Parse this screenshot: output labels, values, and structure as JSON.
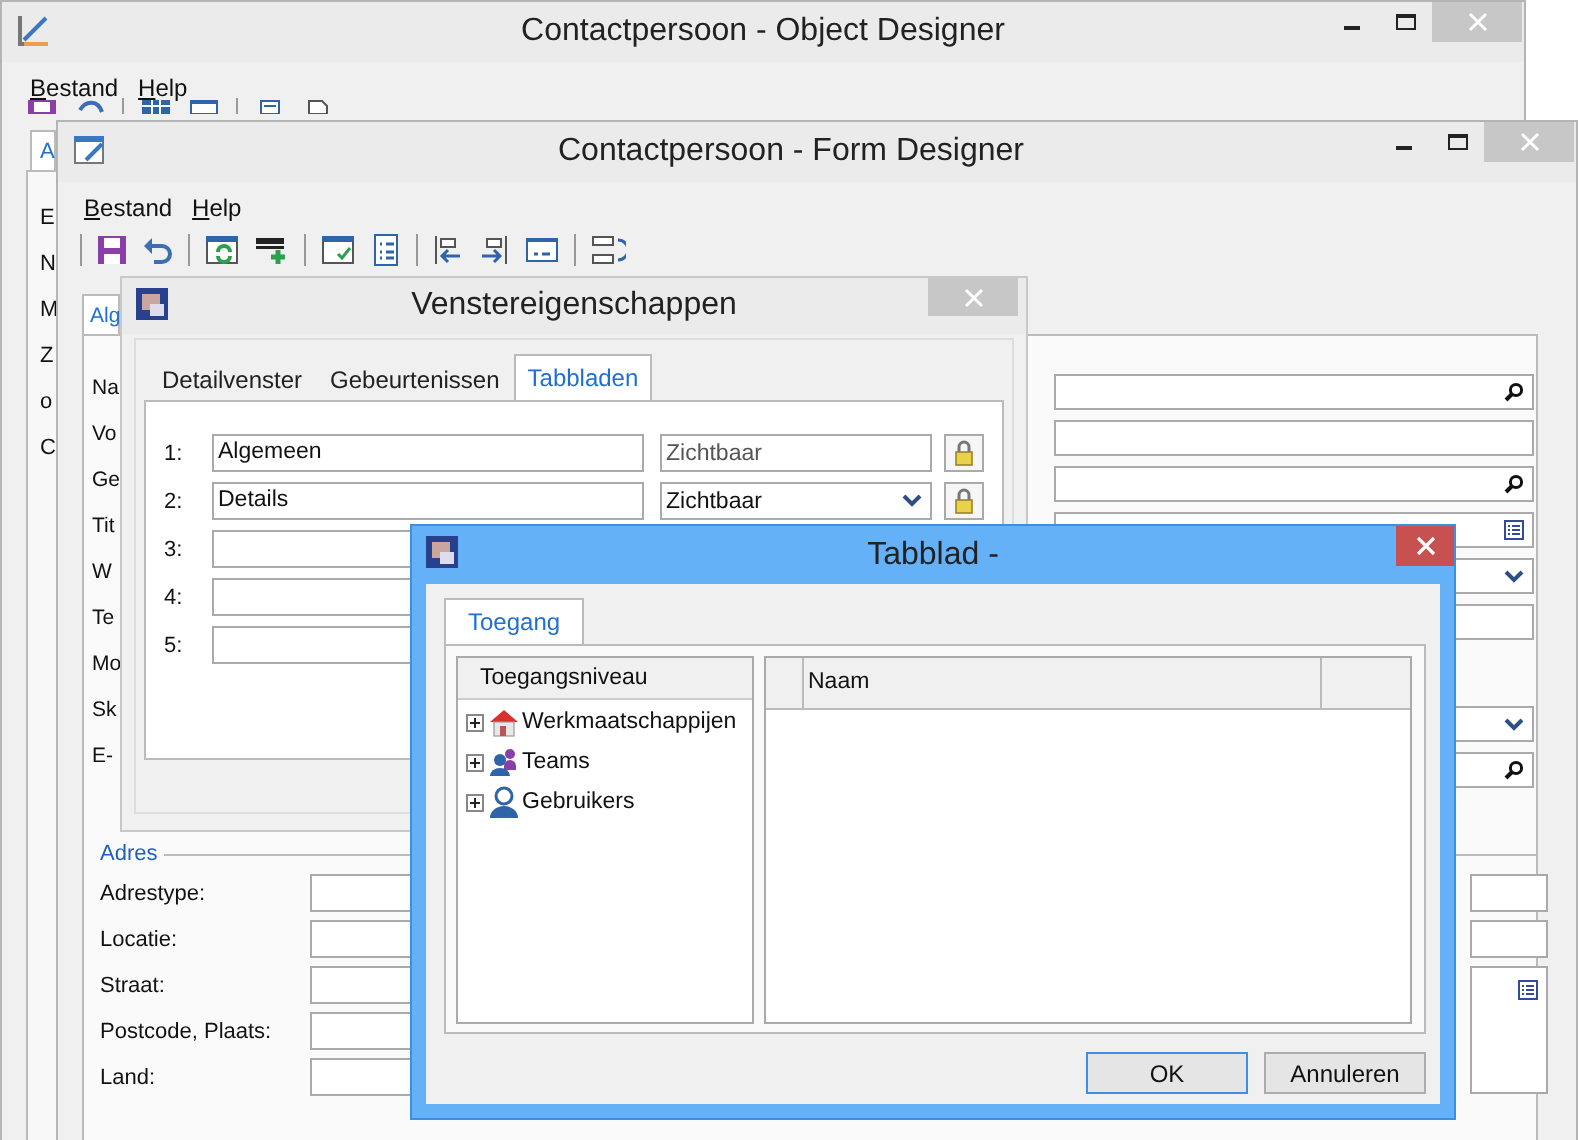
{
  "object_designer": {
    "title": "Contactpersoon - Object Designer",
    "menu": [
      "Bestand",
      "Help"
    ],
    "tabs": [
      {
        "label": "A",
        "selected": true
      }
    ],
    "side_items": [
      "E",
      "N",
      "M",
      "Z",
      "o",
      "C"
    ]
  },
  "form_designer": {
    "title": "Contactpersoon - Form Designer",
    "menu": [
      "Bestand",
      "Help"
    ],
    "tabs": [
      {
        "label": "Alg",
        "selected": true
      }
    ],
    "field_labels": [
      "Na",
      "Vo",
      "Ge",
      "Tit",
      "W",
      "Te",
      "Mo",
      "Sk",
      "E-"
    ],
    "right_fields": [
      {
        "kind": "search"
      },
      {
        "kind": "plain"
      },
      {
        "kind": "search"
      },
      {
        "kind": "list"
      },
      {
        "kind": "dropdown"
      },
      {
        "kind": "plain"
      },
      {
        "kind": "gap"
      },
      {
        "kind": "dropdown"
      },
      {
        "kind": "search"
      }
    ],
    "address": {
      "title": "Adres",
      "labels": [
        "Adrestype:",
        "Locatie:",
        "Straat:",
        "Postcode, Plaats:",
        "Land:"
      ]
    }
  },
  "window_properties": {
    "title": "Venstereigenschappen",
    "tabs": [
      {
        "label": "Detailvenster",
        "selected": false
      },
      {
        "label": "Gebeurtenissen",
        "selected": false
      },
      {
        "label": "Tabbladen",
        "selected": true
      }
    ],
    "rows": [
      {
        "number": "1:",
        "name": "Algemeen",
        "visibility": "Zichtbaar",
        "kind": "text",
        "locked": true
      },
      {
        "number": "2:",
        "name": "Details",
        "visibility": "Zichtbaar",
        "kind": "dropdown",
        "locked": true
      },
      {
        "number": "3:",
        "kind": "covered"
      },
      {
        "number": "4:",
        "kind": "covered"
      },
      {
        "number": "5:",
        "kind": "covered"
      }
    ]
  },
  "tab_dialog": {
    "title": "Tabblad -",
    "tabs": [
      {
        "label": "Toegang",
        "selected": true
      }
    ],
    "tree": {
      "header": "Toegangsniveau",
      "items": [
        {
          "label": "Werkmaatschappijen",
          "kind": "company",
          "expanded": false
        },
        {
          "label": "Teams",
          "kind": "team",
          "expanded": false
        },
        {
          "label": "Gebruikers",
          "kind": "user",
          "expanded": false
        }
      ]
    },
    "list": {
      "columns": [
        {
          "label": "Naam"
        }
      ]
    },
    "buttons": [
      {
        "label": "OK",
        "default": true
      },
      {
        "label": "Annuleren",
        "default": false
      }
    ]
  }
}
